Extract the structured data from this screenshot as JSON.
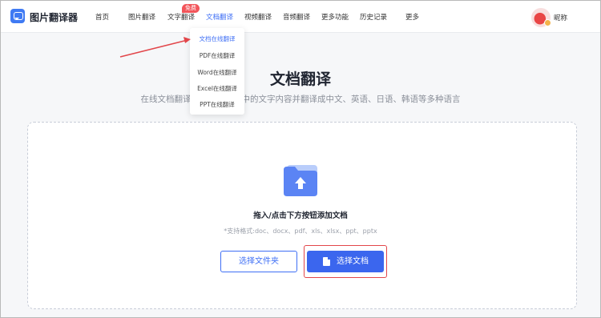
{
  "header": {
    "app_name": "图片翻译器",
    "nav": [
      "首页",
      "图片翻译",
      "文字翻译",
      "文档翻译",
      "视频翻译",
      "音频翻译",
      "更多功能",
      "历史记录",
      "更多"
    ],
    "active_nav": "文档翻译",
    "badge": "免费",
    "username": "昵称"
  },
  "dropdown": {
    "items": [
      "文档在线翻译",
      "PDF在线翻译",
      "Word在线翻译",
      "Excel在线翻译",
      "PPT在线翻译"
    ],
    "active_item": "文档在线翻译"
  },
  "main": {
    "title": "文档翻译",
    "subtitle": "在线文档翻译软件，将文档中的文字内容并翻译成中文、英语、日语、韩语等多种语言",
    "upload_hint": "拖入/点击下方按钮添加文档",
    "formats": "*支持格式:doc、docx、pdf、xls、xlsx、ppt、pptx",
    "select_folder_label": "选择文件夹",
    "select_doc_label": "选择文档"
  },
  "colors": {
    "accent": "#3f6ff5",
    "badge": "#f2555a",
    "annotation": "#e2464a"
  },
  "icons": {
    "logo": "chat-bubble-icon",
    "upload": "folder-upload-icon",
    "document": "document-icon"
  }
}
